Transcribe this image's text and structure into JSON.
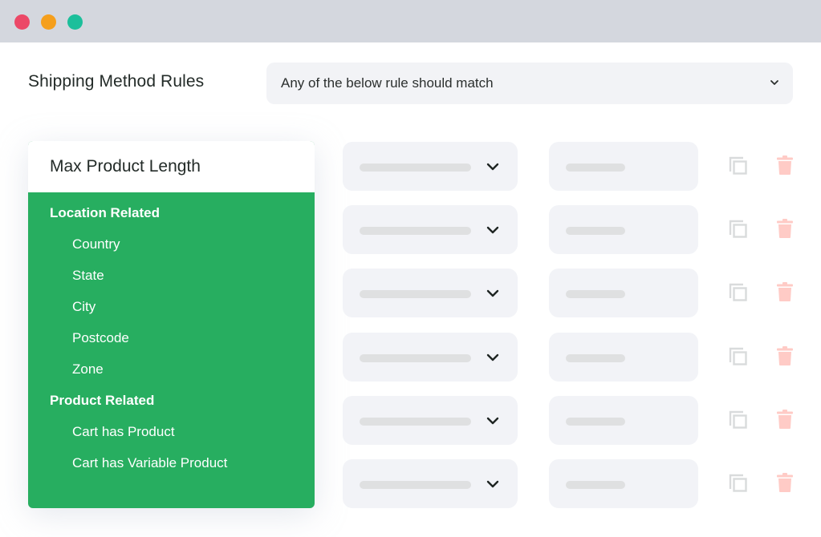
{
  "window": {
    "controls": [
      {
        "name": "close",
        "color": "#ec4867"
      },
      {
        "name": "minimize",
        "color": "#f59f1c"
      },
      {
        "name": "maximize",
        "color": "#1cbf9b"
      }
    ]
  },
  "header": {
    "title": "Shipping Method Rules",
    "match_select": {
      "value": "Any of the below rule should match",
      "icon": "chevron-down-icon"
    }
  },
  "dropdown_panel": {
    "selected": "Max Product Length",
    "accent_color": "#27ae60",
    "groups": [
      {
        "label": "Location Related",
        "options": [
          "Country",
          "State",
          "City",
          "Postcode",
          "Zone"
        ]
      },
      {
        "label": "Product Related",
        "options": [
          "Cart has Product",
          "Cart has Variable Product"
        ]
      }
    ]
  },
  "rule_rows": {
    "count": 6,
    "icons": {
      "select_chevron": "chevron-down-icon",
      "duplicate": "copy-icon",
      "delete": "trash-icon"
    },
    "delete_color": "#ffcbc6",
    "duplicate_color": "#d9dbdc"
  }
}
